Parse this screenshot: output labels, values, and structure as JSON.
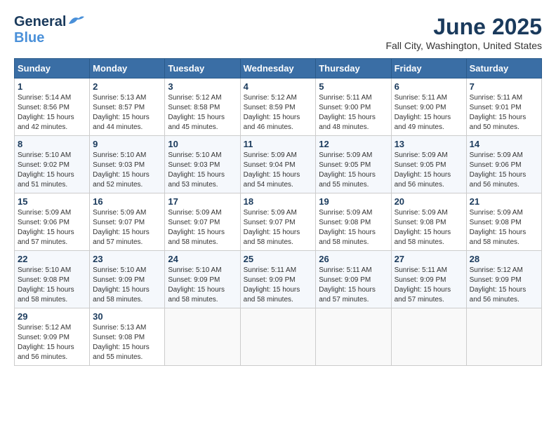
{
  "header": {
    "logo_general": "General",
    "logo_blue": "Blue",
    "month": "June 2025",
    "location": "Fall City, Washington, United States"
  },
  "weekdays": [
    "Sunday",
    "Monday",
    "Tuesday",
    "Wednesday",
    "Thursday",
    "Friday",
    "Saturday"
  ],
  "weeks": [
    [
      {
        "day": "1",
        "sunrise": "5:14 AM",
        "sunset": "8:56 PM",
        "daylight": "15 hours and 42 minutes."
      },
      {
        "day": "2",
        "sunrise": "5:13 AM",
        "sunset": "8:57 PM",
        "daylight": "15 hours and 44 minutes."
      },
      {
        "day": "3",
        "sunrise": "5:12 AM",
        "sunset": "8:58 PM",
        "daylight": "15 hours and 45 minutes."
      },
      {
        "day": "4",
        "sunrise": "5:12 AM",
        "sunset": "8:59 PM",
        "daylight": "15 hours and 46 minutes."
      },
      {
        "day": "5",
        "sunrise": "5:11 AM",
        "sunset": "9:00 PM",
        "daylight": "15 hours and 48 minutes."
      },
      {
        "day": "6",
        "sunrise": "5:11 AM",
        "sunset": "9:00 PM",
        "daylight": "15 hours and 49 minutes."
      },
      {
        "day": "7",
        "sunrise": "5:11 AM",
        "sunset": "9:01 PM",
        "daylight": "15 hours and 50 minutes."
      }
    ],
    [
      {
        "day": "8",
        "sunrise": "5:10 AM",
        "sunset": "9:02 PM",
        "daylight": "15 hours and 51 minutes."
      },
      {
        "day": "9",
        "sunrise": "5:10 AM",
        "sunset": "9:03 PM",
        "daylight": "15 hours and 52 minutes."
      },
      {
        "day": "10",
        "sunrise": "5:10 AM",
        "sunset": "9:03 PM",
        "daylight": "15 hours and 53 minutes."
      },
      {
        "day": "11",
        "sunrise": "5:09 AM",
        "sunset": "9:04 PM",
        "daylight": "15 hours and 54 minutes."
      },
      {
        "day": "12",
        "sunrise": "5:09 AM",
        "sunset": "9:05 PM",
        "daylight": "15 hours and 55 minutes."
      },
      {
        "day": "13",
        "sunrise": "5:09 AM",
        "sunset": "9:05 PM",
        "daylight": "15 hours and 56 minutes."
      },
      {
        "day": "14",
        "sunrise": "5:09 AM",
        "sunset": "9:06 PM",
        "daylight": "15 hours and 56 minutes."
      }
    ],
    [
      {
        "day": "15",
        "sunrise": "5:09 AM",
        "sunset": "9:06 PM",
        "daylight": "15 hours and 57 minutes."
      },
      {
        "day": "16",
        "sunrise": "5:09 AM",
        "sunset": "9:07 PM",
        "daylight": "15 hours and 57 minutes."
      },
      {
        "day": "17",
        "sunrise": "5:09 AM",
        "sunset": "9:07 PM",
        "daylight": "15 hours and 58 minutes."
      },
      {
        "day": "18",
        "sunrise": "5:09 AM",
        "sunset": "9:07 PM",
        "daylight": "15 hours and 58 minutes."
      },
      {
        "day": "19",
        "sunrise": "5:09 AM",
        "sunset": "9:08 PM",
        "daylight": "15 hours and 58 minutes."
      },
      {
        "day": "20",
        "sunrise": "5:09 AM",
        "sunset": "9:08 PM",
        "daylight": "15 hours and 58 minutes."
      },
      {
        "day": "21",
        "sunrise": "5:09 AM",
        "sunset": "9:08 PM",
        "daylight": "15 hours and 58 minutes."
      }
    ],
    [
      {
        "day": "22",
        "sunrise": "5:10 AM",
        "sunset": "9:08 PM",
        "daylight": "15 hours and 58 minutes."
      },
      {
        "day": "23",
        "sunrise": "5:10 AM",
        "sunset": "9:09 PM",
        "daylight": "15 hours and 58 minutes."
      },
      {
        "day": "24",
        "sunrise": "5:10 AM",
        "sunset": "9:09 PM",
        "daylight": "15 hours and 58 minutes."
      },
      {
        "day": "25",
        "sunrise": "5:11 AM",
        "sunset": "9:09 PM",
        "daylight": "15 hours and 58 minutes."
      },
      {
        "day": "26",
        "sunrise": "5:11 AM",
        "sunset": "9:09 PM",
        "daylight": "15 hours and 57 minutes."
      },
      {
        "day": "27",
        "sunrise": "5:11 AM",
        "sunset": "9:09 PM",
        "daylight": "15 hours and 57 minutes."
      },
      {
        "day": "28",
        "sunrise": "5:12 AM",
        "sunset": "9:09 PM",
        "daylight": "15 hours and 56 minutes."
      }
    ],
    [
      {
        "day": "29",
        "sunrise": "5:12 AM",
        "sunset": "9:09 PM",
        "daylight": "15 hours and 56 minutes."
      },
      {
        "day": "30",
        "sunrise": "5:13 AM",
        "sunset": "9:08 PM",
        "daylight": "15 hours and 55 minutes."
      },
      null,
      null,
      null,
      null,
      null
    ]
  ]
}
